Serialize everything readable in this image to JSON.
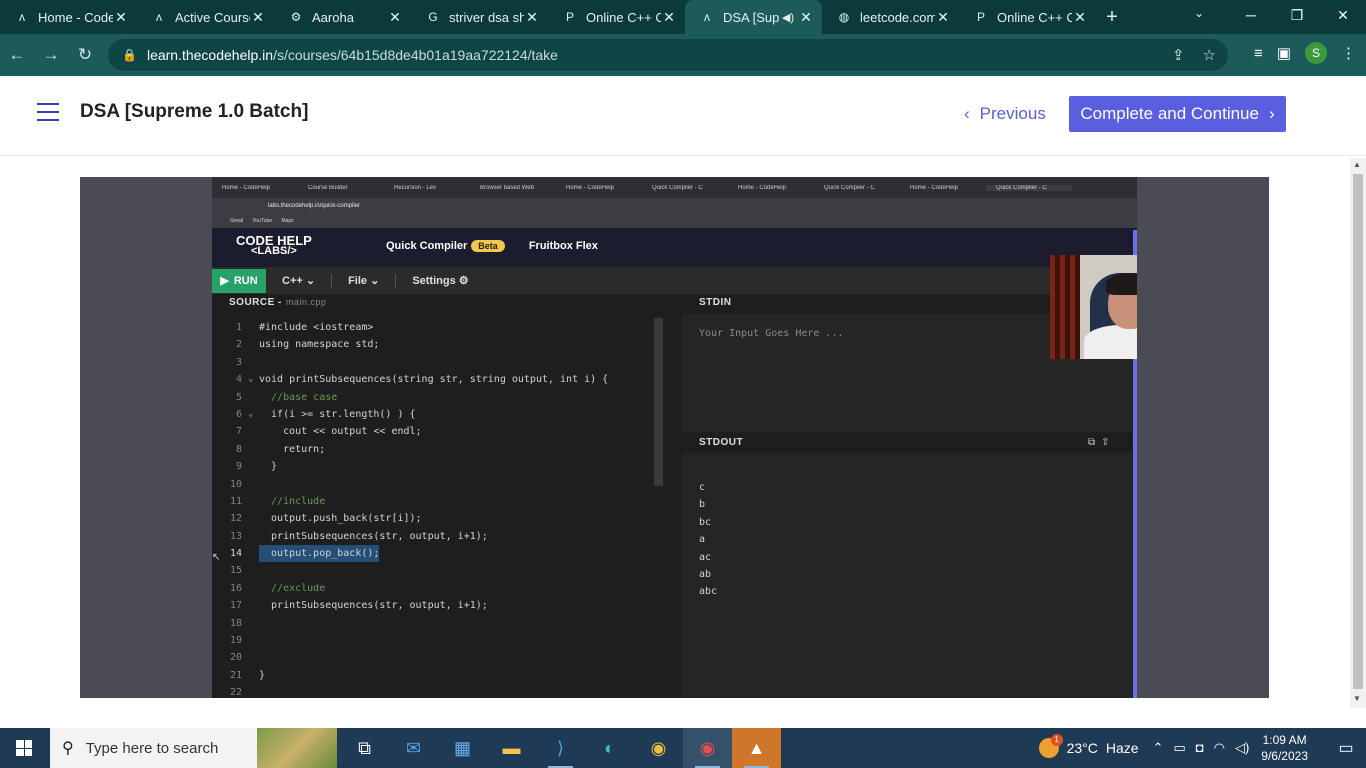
{
  "browser": {
    "tabs": [
      {
        "label": "Home - Code",
        "icon": "codehelp-icon",
        "active": false
      },
      {
        "label": "Active Course",
        "icon": "codehelp-icon",
        "active": false
      },
      {
        "label": "Aaroha",
        "icon": "settings-icon",
        "active": false
      },
      {
        "label": "striver dsa sh",
        "icon": "google-icon",
        "active": false
      },
      {
        "label": "Online C++ C",
        "icon": "compiler-icon",
        "active": false
      },
      {
        "label": "DSA [Sup",
        "icon": "codehelp-icon",
        "active": true,
        "audio": true
      },
      {
        "label": "leetcode.com",
        "icon": "globe-icon",
        "active": false
      },
      {
        "label": "Online C++ C",
        "icon": "compiler-icon",
        "active": false
      }
    ],
    "url_domain": "learn.thecodehelp.in",
    "url_path": "/s/courses/64b15d8de4b01a19aa722124/take",
    "profile_initial": "S"
  },
  "course": {
    "title": "DSA [Supreme 1.0 Batch]",
    "previous_label": "Previous",
    "complete_label": "Complete and Continue"
  },
  "video": {
    "inner_tabs": [
      "Home - CodeHelp",
      "Course Builder",
      "Recursion - Lev",
      "Browser based Web",
      "Home - CodeHelp",
      "Quick Compiler - C",
      "Home - CodeHelp",
      "Quick Compiler - C",
      "Home - CodeHelp",
      "Quick Compiler - C"
    ],
    "inner_url": "labs.thecodehelp.in/quick-compiler",
    "inner_bookmarks": "Gmail YouTube Maps",
    "labs": {
      "logo_top": "CODE HELP",
      "logo_bottom": "<LABS/>",
      "nav_quick": "Quick Compiler",
      "nav_beta": "Beta",
      "nav_fruitbox": "Fruitbox Flex",
      "run_label": "RUN",
      "lang_label": "C++",
      "file_label": "File",
      "settings_label": "Settings",
      "source_label": "SOURCE -",
      "source_file": "main.cpp",
      "stdin_label": "STDIN",
      "stdin_placeholder": "Your Input Goes Here ...",
      "stdout_label": "STDOUT",
      "stdout_lines": [
        "c",
        "b",
        "bc",
        "a",
        "ac",
        "ab",
        "abc"
      ]
    },
    "code_lines": [
      {
        "n": "1",
        "t": "#include <iostream>"
      },
      {
        "n": "2",
        "t": "using namespace std;"
      },
      {
        "n": "3",
        "t": ""
      },
      {
        "n": "4",
        "t": "void printSubsequences(string str, string output, int i) {"
      },
      {
        "n": "5",
        "t": "  //base case"
      },
      {
        "n": "6",
        "t": "  if(i >= str.length() ) {"
      },
      {
        "n": "7",
        "t": "    cout << output << endl;"
      },
      {
        "n": "8",
        "t": "    return;"
      },
      {
        "n": "9",
        "t": "  }"
      },
      {
        "n": "10",
        "t": ""
      },
      {
        "n": "11",
        "t": "  //include"
      },
      {
        "n": "12",
        "t": "  output.push_back(str[i]);"
      },
      {
        "n": "13",
        "t": "  printSubsequences(str, output, i+1);"
      },
      {
        "n": "14",
        "t": "  output.pop_back();"
      },
      {
        "n": "15",
        "t": ""
      },
      {
        "n": "16",
        "t": "  //exclude"
      },
      {
        "n": "17",
        "t": "  printSubsequences(str, output, i+1);"
      },
      {
        "n": "18",
        "t": ""
      },
      {
        "n": "19",
        "t": ""
      },
      {
        "n": "20",
        "t": ""
      },
      {
        "n": "21",
        "t": "}"
      },
      {
        "n": "22",
        "t": ""
      }
    ]
  },
  "taskbar": {
    "search_placeholder": "Type here to search",
    "weather_temp": "23°C",
    "weather_desc": "Haze",
    "weather_badge": "1",
    "time": "1:09 AM",
    "date": "9/6/2023"
  }
}
